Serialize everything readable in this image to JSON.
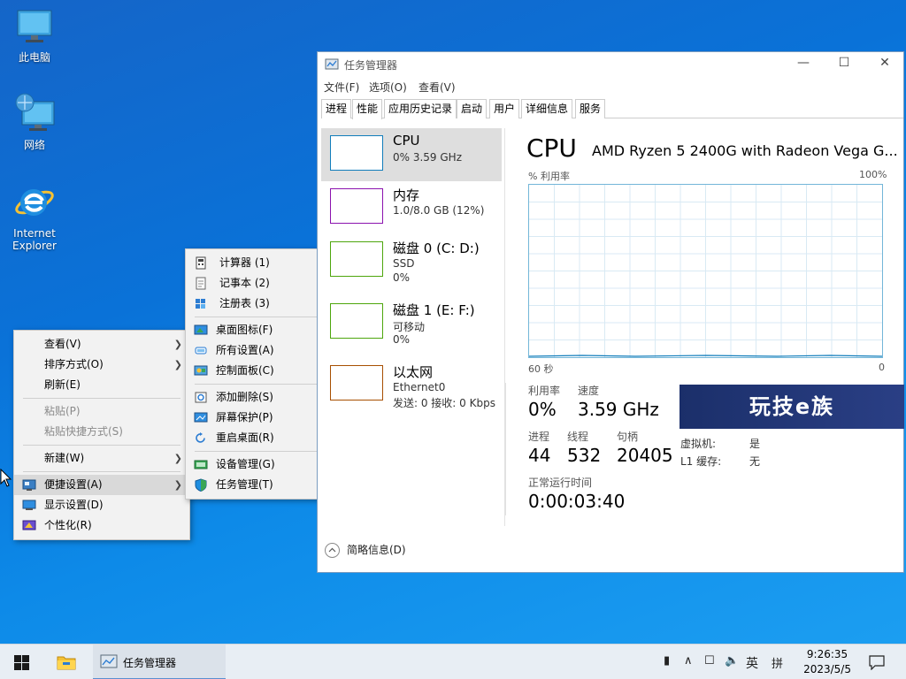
{
  "desktop": {
    "icons": [
      {
        "label": "此电脑"
      },
      {
        "label": "网络"
      },
      {
        "label_line1": "Internet",
        "label_line2": "Explorer"
      }
    ]
  },
  "context_menu": {
    "items": [
      "查看(V)",
      "排序方式(O)",
      "刷新(E)",
      "粘贴(P)",
      "粘贴快捷方式(S)",
      "新建(W)",
      "便捷设置(A)",
      "显示设置(D)",
      "个性化(R)"
    ]
  },
  "submenu": {
    "items": [
      "计算器  (1)",
      "记事本  (2)",
      "注册表  (3)",
      "桌面图标(F)",
      "所有设置(A)",
      "控制面板(C)",
      "添加删除(S)",
      "屏幕保护(P)",
      "重启桌面(R)",
      "设备管理(G)",
      "任务管理(T)"
    ]
  },
  "task_manager": {
    "title": "任务管理器",
    "menu": [
      "文件(F)",
      "选项(O)",
      "查看(V)"
    ],
    "tabs": [
      "进程",
      "性能",
      "应用历史记录",
      "启动",
      "用户",
      "详细信息",
      "服务"
    ],
    "active_tab": "性能",
    "sidebar": [
      {
        "name": "CPU",
        "line2": "0% 3.59 GHz",
        "line3": "",
        "color": "#117dbb"
      },
      {
        "name": "内存",
        "line2": "1.0/8.0 GB (12%)",
        "line3": "",
        "color": "#8b12ae"
      },
      {
        "name": "磁盘 0 (C: D:)",
        "line2": "SSD",
        "line3": "0%",
        "color": "#4da60c"
      },
      {
        "name": "磁盘 1 (E: F:)",
        "line2": "可移动",
        "line3": "0%",
        "color": "#4da60c"
      },
      {
        "name": "以太网",
        "line2": "Ethernet0",
        "line3": "发送: 0  接收: 0 Kbps",
        "color": "#a74f01"
      }
    ],
    "detail": {
      "heading": "CPU",
      "cpu_name": "AMD Ryzen 5 2400G with Radeon Vega G...",
      "graph_label": "% 利用率",
      "graph_max": "100%",
      "graph_time": "60 秒",
      "graph_min": "0",
      "utilization_label": "利用率",
      "utilization": "0%",
      "speed_label": "速度",
      "speed": "3.59 GHz",
      "processes_label": "进程",
      "processes": "44",
      "threads_label": "线程",
      "threads": "532",
      "handles_label": "句柄",
      "handles": "20405",
      "uptime_label": "正常运行时间",
      "uptime": "0:00:03:40",
      "vm_label": "虚拟机:",
      "vm_value": "是",
      "l1_label": "L1 缓存:",
      "l1_value": "无"
    },
    "brief": "简略信息(D)"
  },
  "watermark": "玩技e族",
  "taskbar": {
    "app_label": "任务管理器",
    "ime": "英",
    "ime2": "拼",
    "time": "9:26:35",
    "date": "2023/5/5"
  },
  "colors": {
    "accent": "#117dbb",
    "graph_border": "#73b6d8"
  }
}
